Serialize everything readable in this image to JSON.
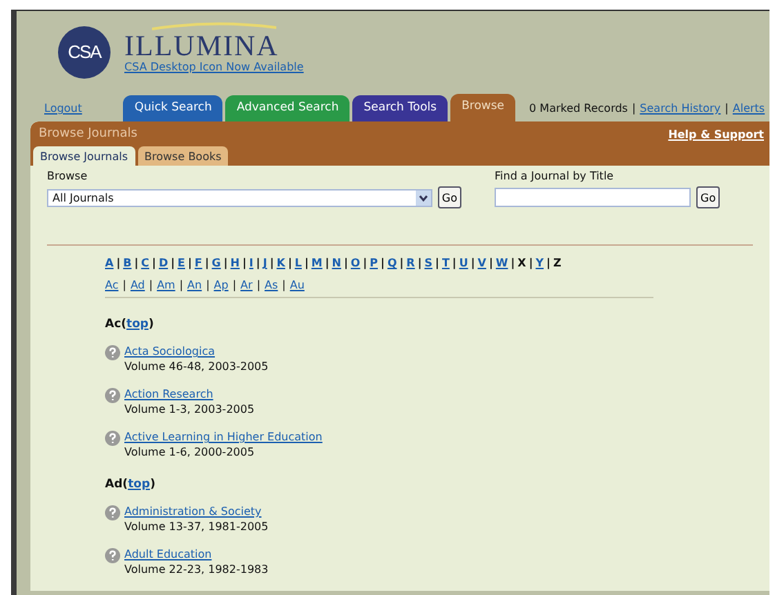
{
  "header": {
    "logo_badge": "CSA",
    "logo_title": "ILLUMINA",
    "notice_link": "CSA Desktop Icon Now Available"
  },
  "nav": {
    "logout": "Logout",
    "tabs": [
      {
        "label": "Quick Search",
        "color": "#2462b0",
        "selected": false
      },
      {
        "label": "Advanced Search",
        "color": "#2a9a48",
        "selected": false
      },
      {
        "label": "Search Tools",
        "color": "#3a3596",
        "selected": false
      },
      {
        "label": "Browse",
        "color": "#a2602a",
        "selected": true
      }
    ],
    "marked_records": "0 Marked Records",
    "links": [
      {
        "separator": "|",
        "label": "Search History"
      },
      {
        "separator": "|",
        "label": "Alerts"
      }
    ]
  },
  "section": {
    "title": "Browse Journals",
    "help": "Help & Support"
  },
  "subtabs": [
    {
      "label": "Browse Journals",
      "selected": true
    },
    {
      "label": "Browse Books",
      "selected": false
    }
  ],
  "browse": {
    "label": "Browse",
    "value": "All Journals",
    "button": "Go"
  },
  "find": {
    "label": "Find a Journal by Title",
    "button": "Go"
  },
  "letters": [
    {
      "text": "A",
      "available": true
    },
    {
      "separator": "|",
      "text": "B",
      "available": true
    },
    {
      "separator": "|",
      "text": "C",
      "available": true
    },
    {
      "separator": "|",
      "text": "D",
      "available": true
    },
    {
      "separator": "|",
      "text": "E",
      "available": true
    },
    {
      "separator": "|",
      "text": "F",
      "available": true
    },
    {
      "separator": "|",
      "text": "G",
      "available": true
    },
    {
      "separator": "|",
      "text": "H",
      "available": true
    },
    {
      "separator": "|",
      "text": "I",
      "available": true
    },
    {
      "separator": "|",
      "text": "J",
      "available": true
    },
    {
      "separator": "|",
      "text": "K",
      "available": true
    },
    {
      "separator": "|",
      "text": "L",
      "available": true
    },
    {
      "separator": "|",
      "text": "M",
      "available": true
    },
    {
      "separator": "|",
      "text": "N",
      "available": true
    },
    {
      "separator": "|",
      "text": "O",
      "available": true
    },
    {
      "separator": "|",
      "text": "P",
      "available": true
    },
    {
      "separator": "|",
      "text": "Q",
      "available": true
    },
    {
      "separator": "|",
      "text": "R",
      "available": true
    },
    {
      "separator": "|",
      "text": "S",
      "available": true
    },
    {
      "separator": "|",
      "text": "T",
      "available": true
    },
    {
      "separator": "|",
      "text": "U",
      "available": true
    },
    {
      "separator": "|",
      "text": "V",
      "available": true
    },
    {
      "separator": "|",
      "text": "W",
      "available": true
    },
    {
      "separator": "|",
      "text": "X",
      "available": false
    },
    {
      "separator": "|",
      "text": "Y",
      "available": true
    },
    {
      "separator": "|",
      "text": "Z",
      "available": false
    }
  ],
  "prefixes": [
    {
      "text": "Ac"
    },
    {
      "separator": "|",
      "text": "Ad"
    },
    {
      "separator": "|",
      "text": "Am"
    },
    {
      "separator": "|",
      "text": "An"
    },
    {
      "separator": "|",
      "text": "Ap"
    },
    {
      "separator": "|",
      "text": "Ar"
    },
    {
      "separator": "|",
      "text": "As"
    },
    {
      "separator": "|",
      "text": "Au"
    }
  ],
  "groups": [
    {
      "heading": "Ac",
      "open": "(",
      "top_link": "top",
      "close": ")",
      "journals": [
        {
          "title": "Acta Sociologica",
          "volumes": "Volume 46-48, 2003-2005"
        },
        {
          "title": "Action Research",
          "volumes": "Volume 1-3, 2003-2005"
        },
        {
          "title": "Active Learning in Higher Education",
          "volumes": "Volume 1-6, 2000-2005"
        }
      ]
    },
    {
      "heading": "Ad",
      "open": "(",
      "top_link": "top",
      "close": ")",
      "journals": [
        {
          "title": "Administration & Society",
          "volumes": "Volume 13-37, 1981-2005"
        },
        {
          "title": "Adult Education",
          "volumes": "Volume 22-23, 1982-1983"
        }
      ]
    }
  ]
}
